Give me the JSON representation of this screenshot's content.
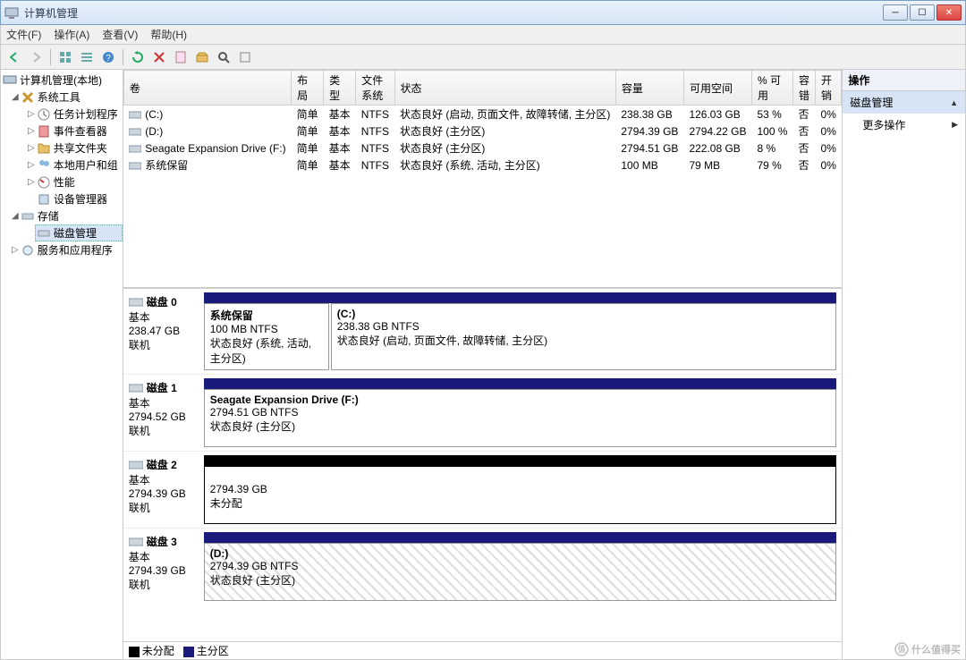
{
  "window": {
    "title": "计算机管理"
  },
  "menu": {
    "file": "文件(F)",
    "action": "操作(A)",
    "view": "查看(V)",
    "help": "帮助(H)"
  },
  "tree": {
    "root": "计算机管理(本地)",
    "tools": "系统工具",
    "task": "任务计划程序",
    "event": "事件查看器",
    "shared": "共享文件夹",
    "users": "本地用户和组",
    "perf": "性能",
    "devmgr": "设备管理器",
    "storage": "存储",
    "diskmgmt": "磁盘管理",
    "services": "服务和应用程序"
  },
  "columns": {
    "volume": "卷",
    "layout": "布局",
    "type": "类型",
    "fs": "文件系统",
    "status": "状态",
    "capacity": "容量",
    "free": "可用空间",
    "pct": "% 可用",
    "fault": "容错",
    "overhead": "开销"
  },
  "volumes": [
    {
      "name": "(C:)",
      "layout": "简单",
      "type": "基本",
      "fs": "NTFS",
      "status": "状态良好 (启动, 页面文件, 故障转储, 主分区)",
      "cap": "238.38 GB",
      "free": "126.03 GB",
      "pct": "53 %",
      "fault": "否",
      "oh": "0%"
    },
    {
      "name": "(D:)",
      "layout": "简单",
      "type": "基本",
      "fs": "NTFS",
      "status": "状态良好 (主分区)",
      "cap": "2794.39 GB",
      "free": "2794.22 GB",
      "pct": "100 %",
      "fault": "否",
      "oh": "0%"
    },
    {
      "name": "Seagate Expansion Drive (F:)",
      "layout": "简单",
      "type": "基本",
      "fs": "NTFS",
      "status": "状态良好 (主分区)",
      "cap": "2794.51 GB",
      "free": "222.08 GB",
      "pct": "8 %",
      "fault": "否",
      "oh": "0%"
    },
    {
      "name": "系统保留",
      "layout": "简单",
      "type": "基本",
      "fs": "NTFS",
      "status": "状态良好 (系统, 活动, 主分区)",
      "cap": "100 MB",
      "free": "79 MB",
      "pct": "79 %",
      "fault": "否",
      "oh": "0%"
    }
  ],
  "disks": [
    {
      "id": "磁盘 0",
      "type": "基本",
      "size": "238.47 GB",
      "state": "联机",
      "parts": [
        {
          "name": "系统保留",
          "line2": "100 MB NTFS",
          "line3": "状态良好 (系统, 活动, 主分区)",
          "flex": "0 0 140px",
          "diag": false
        },
        {
          "name": "(C:)",
          "line2": "238.38 GB NTFS",
          "line3": "状态良好 (启动, 页面文件, 故障转储, 主分区)",
          "flex": "1",
          "diag": false
        }
      ],
      "header": "primary"
    },
    {
      "id": "磁盘 1",
      "type": "基本",
      "size": "2794.52 GB",
      "state": "联机",
      "parts": [
        {
          "name": "Seagate Expansion Drive  (F:)",
          "line2": "2794.51 GB NTFS",
          "line3": "状态良好 (主分区)",
          "flex": "1",
          "diag": false
        }
      ],
      "header": "primary"
    },
    {
      "id": "磁盘 2",
      "type": "基本",
      "size": "2794.39 GB",
      "state": "联机",
      "parts": [
        {
          "name": "",
          "line2": "2794.39 GB",
          "line3": "未分配",
          "flex": "1",
          "diag": false,
          "unalloc": true
        }
      ],
      "header": "unalloc"
    },
    {
      "id": "磁盘 3",
      "type": "基本",
      "size": "2794.39 GB",
      "state": "联机",
      "parts": [
        {
          "name": "(D:)",
          "line2": "2794.39 GB NTFS",
          "line3": "状态良好 (主分区)",
          "flex": "1",
          "diag": true
        }
      ],
      "header": "primary"
    }
  ],
  "legend": {
    "unalloc": "未分配",
    "primary": "主分区"
  },
  "actions": {
    "header": "操作",
    "diskmgmt": "磁盘管理",
    "more": "更多操作"
  },
  "watermark": "什么值得买"
}
